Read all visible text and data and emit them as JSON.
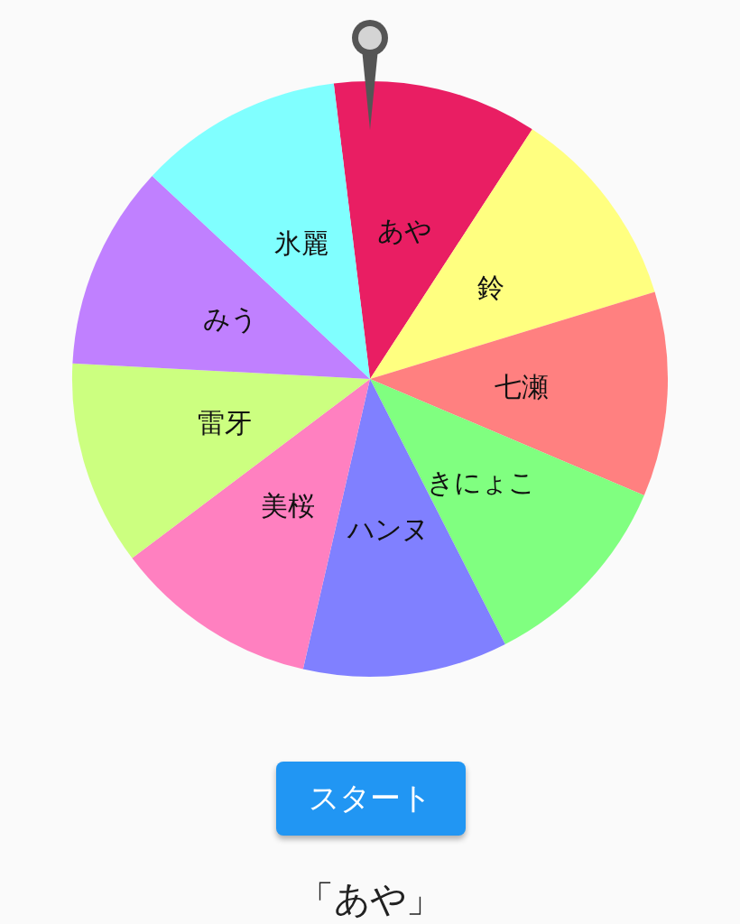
{
  "wheel": {
    "segments": [
      {
        "label": "あや",
        "color": "#e91e63"
      },
      {
        "label": "鈴",
        "color": "#ffff80"
      },
      {
        "label": "七瀬",
        "color": "#ff8080"
      },
      {
        "label": "きにょこ",
        "color": "#80ff80"
      },
      {
        "label": "ハンヌ",
        "color": "#8080ff"
      },
      {
        "label": "美桜",
        "color": "#ff80c0"
      },
      {
        "label": "雷牙",
        "color": "#ccff80"
      },
      {
        "label": "みう",
        "color": "#c080ff"
      },
      {
        "label": "氷麗",
        "color": "#80ffff"
      }
    ]
  },
  "start_button": {
    "label": "スタート"
  },
  "result": "「あや」"
}
